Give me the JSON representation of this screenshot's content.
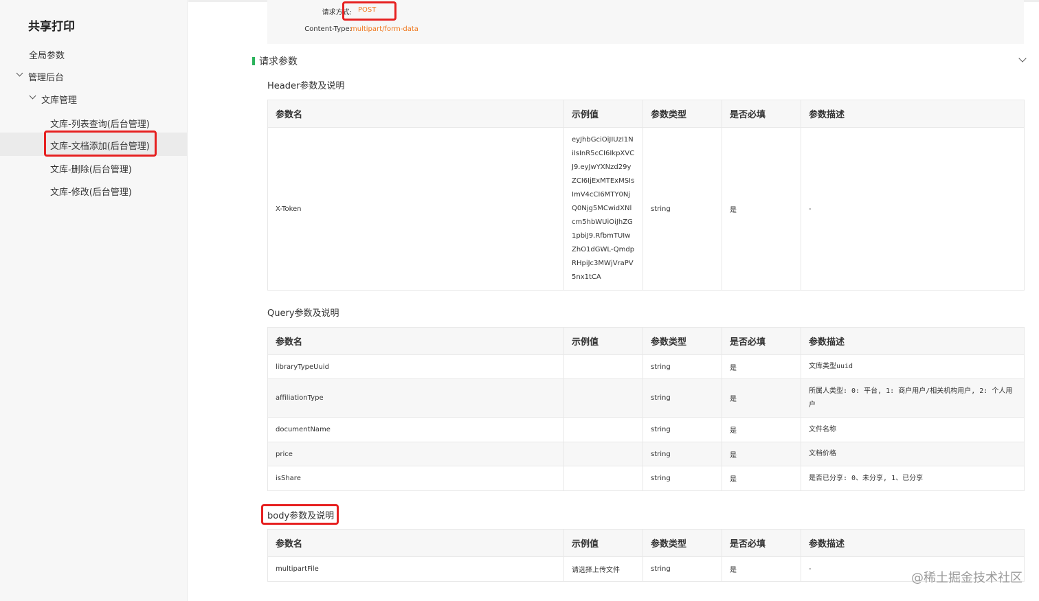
{
  "sidebar": {
    "title": "共享打印",
    "global_params": "全局参数",
    "admin_group": "管理后台",
    "library_group": "文库管理",
    "items": [
      {
        "label": "文库-列表查询(后台管理)"
      },
      {
        "label": "文库-文档添加(后台管理)"
      },
      {
        "label": "文库-删除(后台管理)"
      },
      {
        "label": "文库-修改(后台管理)"
      }
    ]
  },
  "request": {
    "method_label": "请求方式:",
    "method_value": "POST",
    "content_type_label": "Content-Type:",
    "content_type_value": "multipart/form-data"
  },
  "section": {
    "title": "请求参数"
  },
  "columns": [
    "参数名",
    "示例值",
    "参数类型",
    "是否必填",
    "参数描述"
  ],
  "header_params": {
    "title": "Header参数及说明",
    "rows": [
      {
        "name": "X-Token",
        "example": "eyJhbGciOiJIUzI1NiIsInR5cCI6IkpXVCJ9.eyJwYXNzd29yZCI6IjExMTExMSIsImV4cCI6MTY0NjQ0Njg5MCwidXNlcm5hbWUiOiJhZG1pbiJ9.RfbmTUIwZhO1dGWL-QmdpRHpiJc3MWjVraPV5nx1tCA",
        "type": "string",
        "required": "是",
        "desc": "-"
      }
    ]
  },
  "query_params": {
    "title": "Query参数及说明",
    "rows": [
      {
        "name": "libraryTypeUuid",
        "example": "",
        "type": "string",
        "required": "是",
        "desc": "文库类型uuid"
      },
      {
        "name": "affiliationType",
        "example": "",
        "type": "string",
        "required": "是",
        "desc": "所属人类型: 0: 平台, 1: 商户用户/相关机构用户, 2: 个人用户"
      },
      {
        "name": "documentName",
        "example": "",
        "type": "string",
        "required": "是",
        "desc": "文件名称"
      },
      {
        "name": "price",
        "example": "",
        "type": "string",
        "required": "是",
        "desc": "文档价格"
      },
      {
        "name": "isShare",
        "example": "",
        "type": "string",
        "required": "是",
        "desc": "是否已分享: 0、未分享, 1、已分享"
      }
    ]
  },
  "body_params": {
    "title": "body参数及说明",
    "rows": [
      {
        "name": "multipartFile",
        "example": "请选择上传文件",
        "type": "string",
        "required": "是",
        "desc": "-"
      }
    ]
  },
  "watermark": "@稀土掘金技术社区",
  "colors": {
    "accent_orange": "#f0781f",
    "highlight_red": "#e62020",
    "section_green": "#2cb35c"
  }
}
